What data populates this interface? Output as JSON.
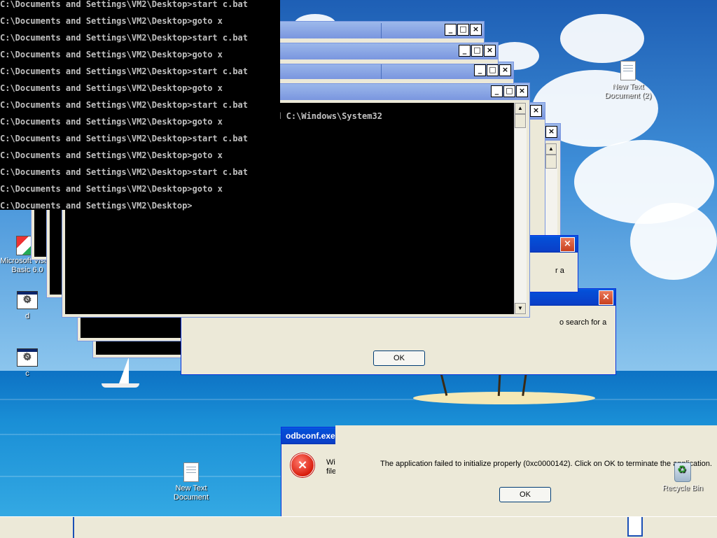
{
  "desktop": {
    "icons": [
      {
        "label": "New Text\nDocument (2)"
      },
      {
        "label": "Microsoft Visual\nBasic 6.0"
      },
      {
        "label": "d"
      },
      {
        "label": "c"
      },
      {
        "label": "New Text\nDocument"
      },
      {
        "label": "Recycle Bin"
      }
    ]
  },
  "console_main": {
    "lines": [
      "C:\\Documents and Settings\\VM2\\Desktop>start c.bat",
      "C:\\Documents and Settings\\VM2\\Desktop>goto x",
      "C:\\Documents and Settings\\VM2\\Desktop>start c.bat",
      "C:\\Documents and Settings\\VM2\\Desktop>goto x",
      "C:\\Documents and Settings\\VM2\\Desktop>start c.bat",
      "C:\\Documents and Settings\\VM2\\Desktop>goto x",
      "C:\\Documents and Settings\\VM2\\Desktop>start c.bat",
      "C:\\Documents and Settings\\VM2\\Desktop>goto x",
      "C:\\Documents and Settings\\VM2\\Desktop>start c.bat",
      "C:\\Documents and Settings\\VM2\\Desktop>goto x",
      "C:\\Documents and Settings\\VM2\\Desktop>start c.bat",
      "C:\\Documents and Settings\\VM2\\Desktop>goto x",
      "C:\\Documents and Settings\\VM2\\Desktop>"
    ]
  },
  "console_behind": {
    "line": "cd C:\\Windows\\System32"
  },
  "dialog_behind": {
    "partial_text_1": "r a",
    "partial_text_2": "o search for a",
    "ok_label": "OK"
  },
  "odbc_dialog": {
    "title": "odbconf.exe",
    "partial_text_1": "Wi",
    "partial_text_2": "file"
  },
  "front_dialog": {
    "message": "The application failed to initialize properly (0xc0000142). Click on OK to terminate the application.",
    "ok_label": "OK"
  },
  "window_buttons": {
    "minimize": "_",
    "maximize": "□",
    "close": "×"
  },
  "colors": {
    "console_text": "#c0c0c0",
    "titlebar_active": "#0a3fc8",
    "titlebar_inactive": "#7a96df",
    "dialog_face": "#ece9d8"
  }
}
